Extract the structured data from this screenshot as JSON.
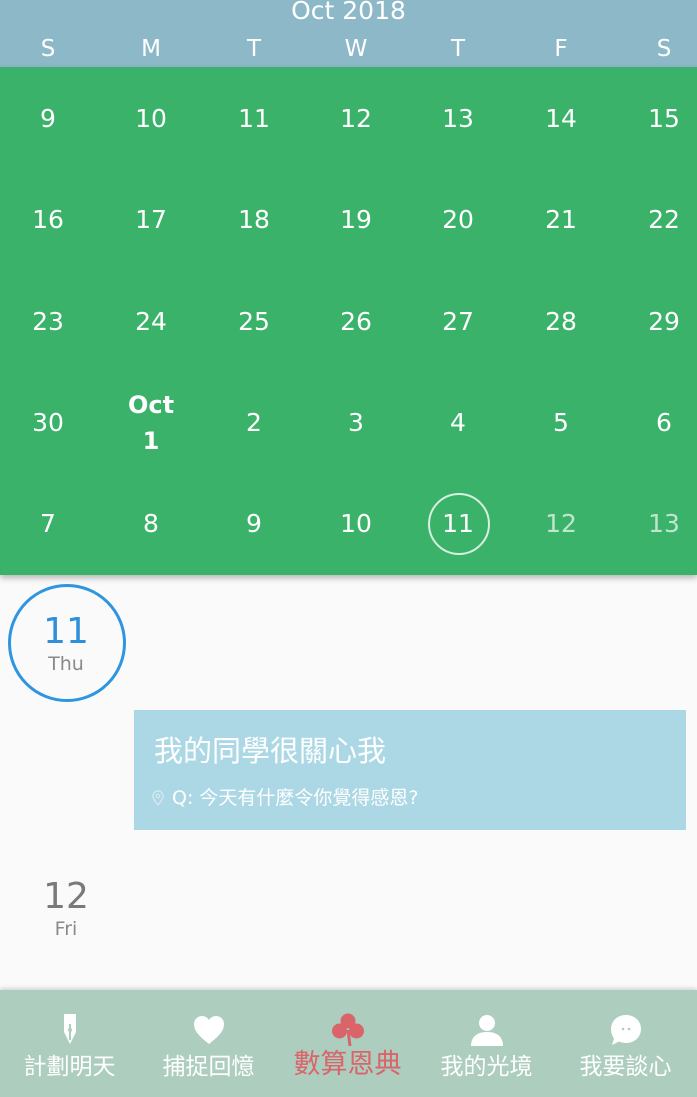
{
  "calendar": {
    "month_title": "Oct 2018",
    "weekdays": [
      "S",
      "M",
      "T",
      "W",
      "T",
      "F",
      "S"
    ],
    "weeks": [
      [
        "9",
        "10",
        "11",
        "12",
        "13",
        "14",
        "15"
      ],
      [
        "16",
        "17",
        "18",
        "19",
        "20",
        "21",
        "22"
      ],
      [
        "23",
        "24",
        "25",
        "26",
        "27",
        "28",
        "29"
      ],
      [
        "30",
        "",
        "2",
        "3",
        "4",
        "5",
        "6"
      ],
      [
        "7",
        "8",
        "9",
        "10",
        "11",
        "12",
        "13"
      ]
    ],
    "month_start_label": "Oct",
    "month_start_day": "1",
    "selected_day": "11"
  },
  "timeline": {
    "days": [
      {
        "num": "11",
        "dow": "Thu"
      },
      {
        "num": "12",
        "dow": "Fri"
      }
    ],
    "entry": {
      "title": "我的同學很關心我",
      "prompt": "Q: 今天有什麼令你覺得感恩?",
      "icon": "location-pin-icon"
    }
  },
  "nav": {
    "items": [
      {
        "label": "計劃明天",
        "icon": "pen-icon"
      },
      {
        "label": "捕捉回憶",
        "icon": "heart-icon"
      },
      {
        "label": "數算恩典",
        "icon": "clover-icon"
      },
      {
        "label": "我的光境",
        "icon": "person-icon"
      },
      {
        "label": "我要談心",
        "icon": "chat-bubble-icon"
      }
    ],
    "active_index": 2
  },
  "colors": {
    "header": "#8db8c8",
    "calendar_green": "#3bb26a",
    "selected_blue": "#2e95e0",
    "card_blue": "#acd8e5",
    "nav_bg": "#adcdbf",
    "active_red": "#d9646a"
  }
}
